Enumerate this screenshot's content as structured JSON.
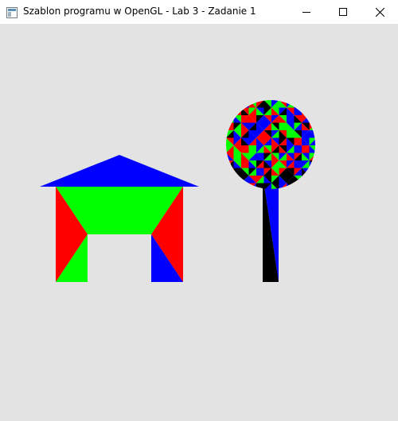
{
  "window": {
    "title": "Szablon programu w OpenGL - Lab 3 - Zadanie 1",
    "app_icon": "window-app-icon",
    "controls": {
      "minimize": "minimize-icon",
      "maximize": "maximize-icon",
      "close": "close-icon"
    }
  },
  "scene": {
    "background": "#e3e3e3",
    "colors": {
      "red": "#ff0000",
      "green": "#00ff00",
      "blue": "#0000ff",
      "black": "#000000"
    },
    "house": {
      "roof": "blue",
      "wall_left": [
        "red",
        "green"
      ],
      "wall_right": [
        "red",
        "blue"
      ],
      "upper_panel": "green"
    },
    "tree": {
      "trunk": [
        "blue",
        "black"
      ],
      "crown": "triangulated-circle"
    }
  }
}
